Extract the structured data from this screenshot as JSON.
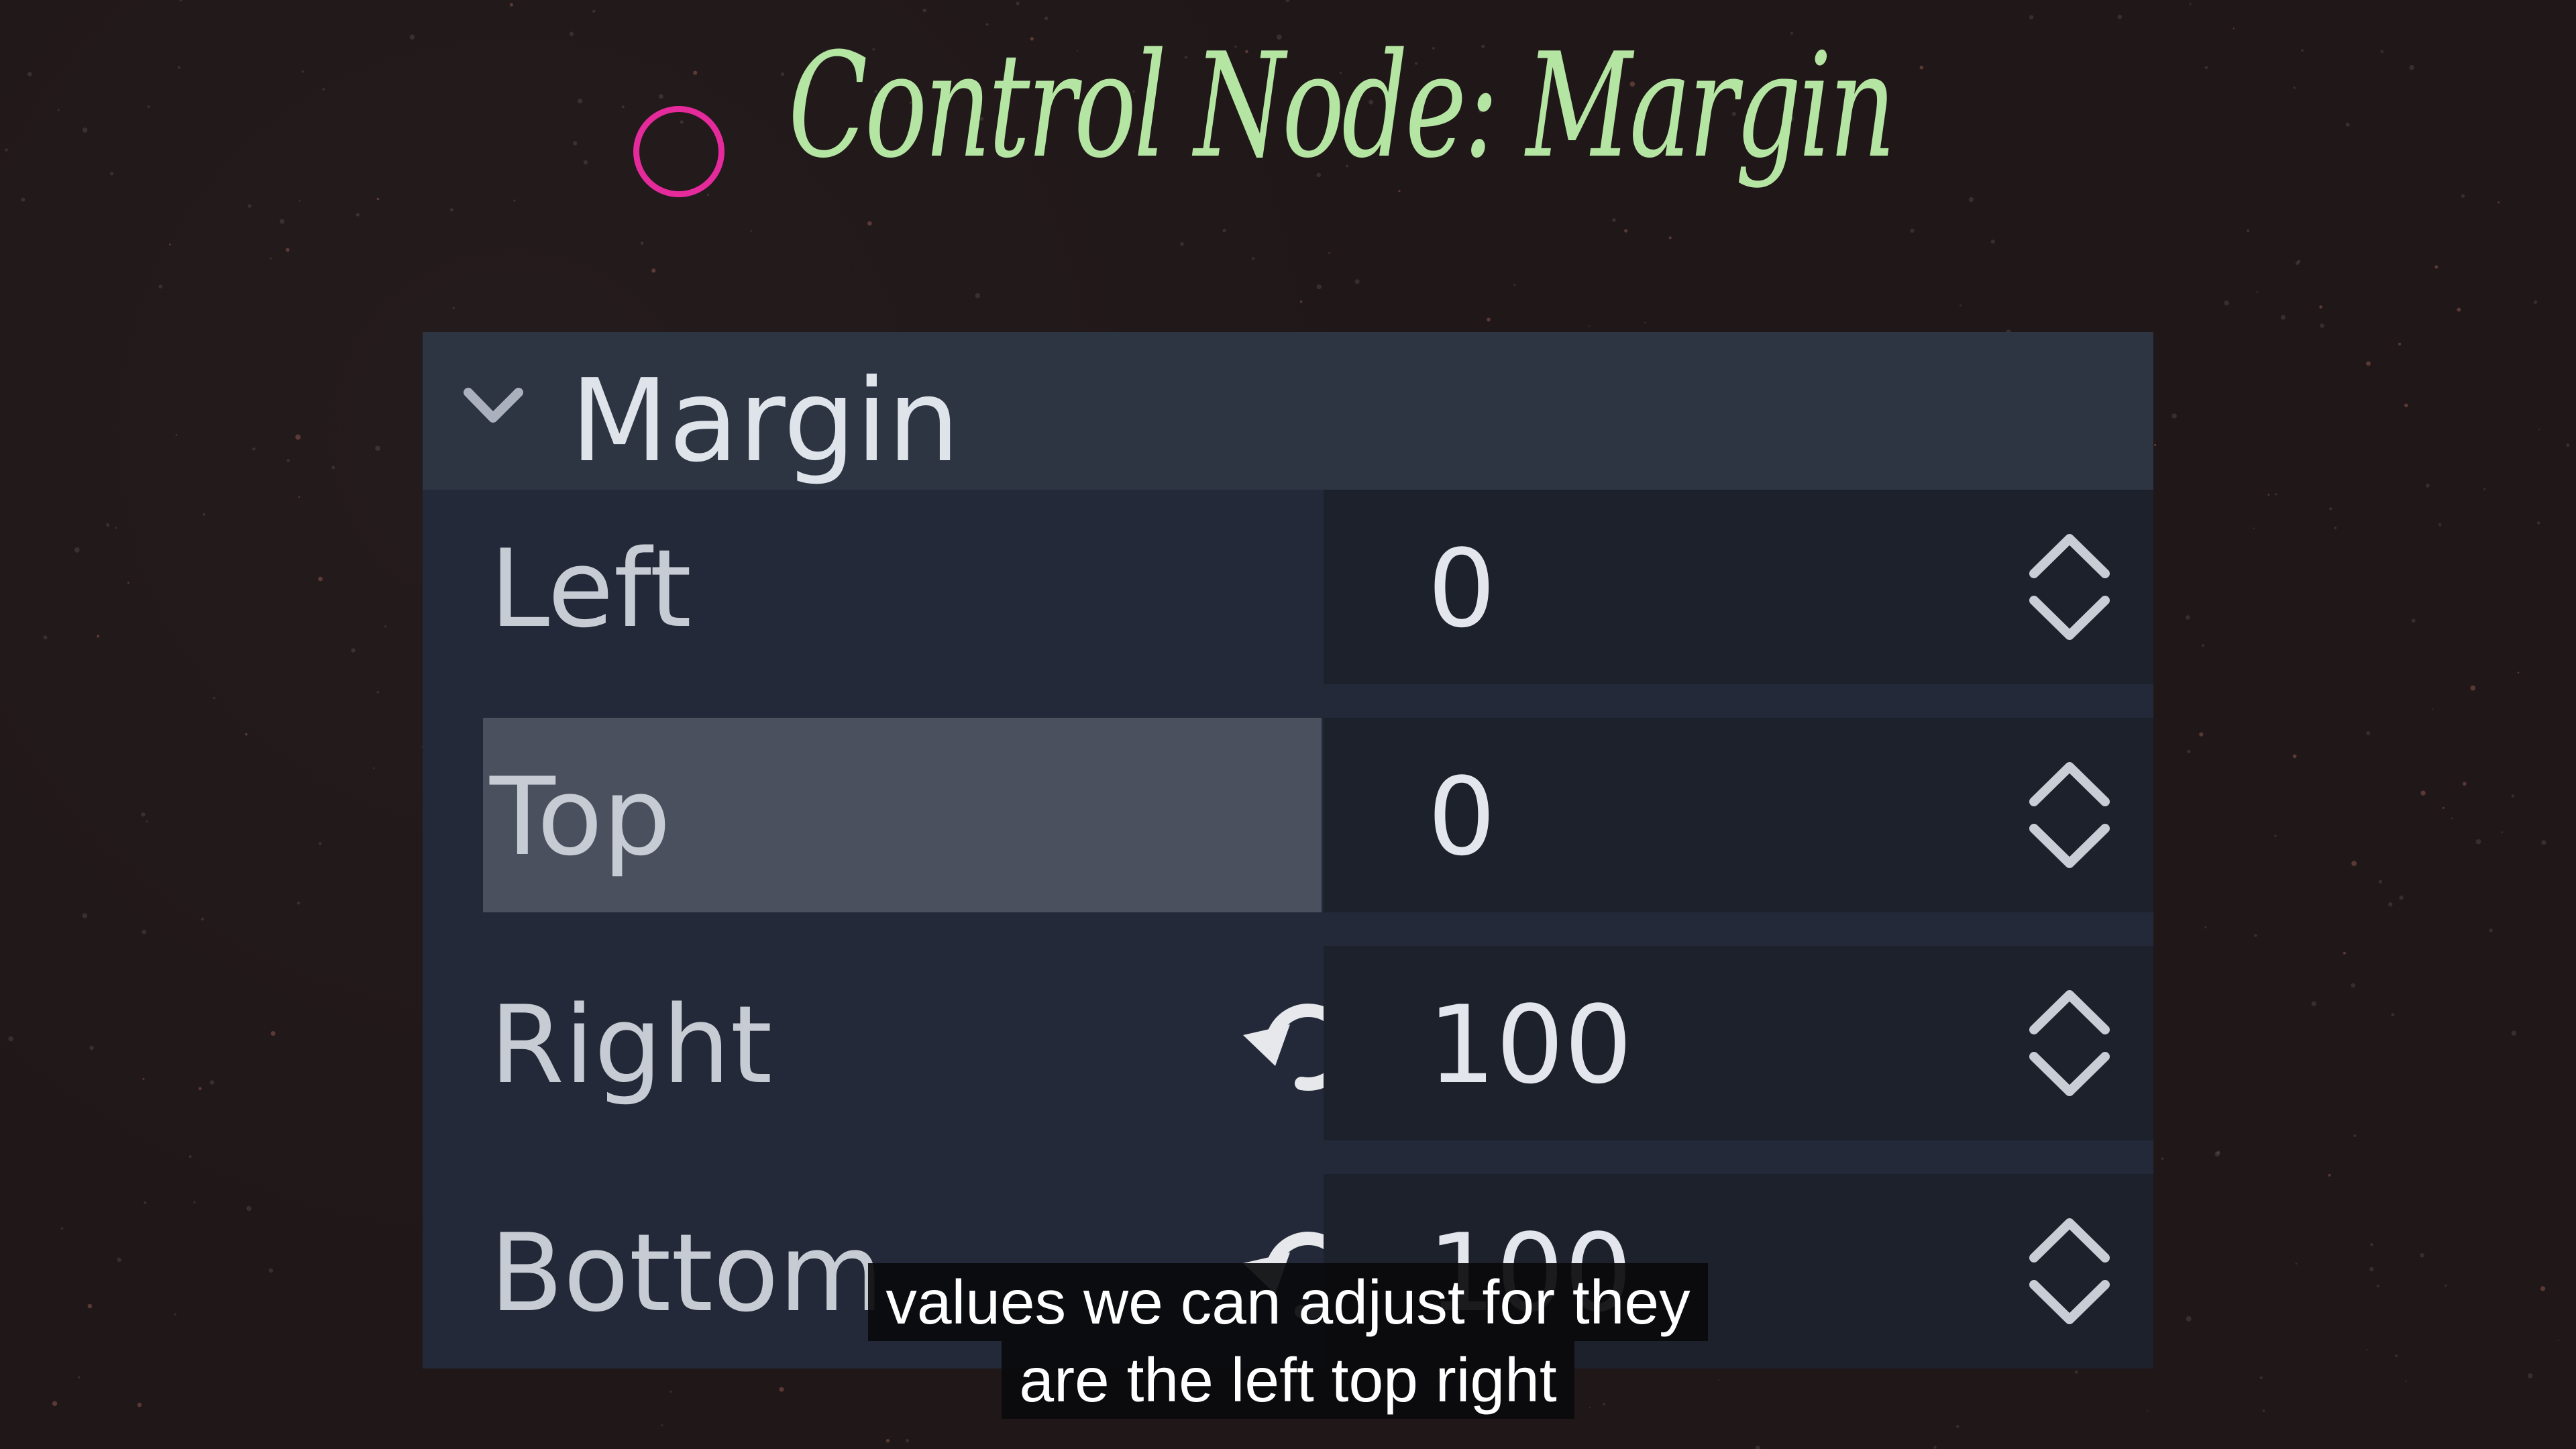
{
  "title": {
    "text": "Control Node: Margin",
    "bullet_color": "#e52a9c",
    "text_color": "#b5e5a2"
  },
  "inspector": {
    "section_title": "Margin",
    "section_icon": "chevron-down-icon",
    "rows": [
      {
        "label": "Left",
        "value": "0",
        "hovered": false,
        "has_reset": false
      },
      {
        "label": "Top",
        "value": "0",
        "hovered": true,
        "has_reset": false
      },
      {
        "label": "Right",
        "value": "100",
        "hovered": false,
        "has_reset": true
      },
      {
        "label": "Bottom",
        "value": "100",
        "hovered": false,
        "has_reset": true
      }
    ],
    "spinner_icon": "up-down-arrows-icon",
    "reset_icon": "revert-icon"
  },
  "captions": {
    "line1": "values we can adjust for they",
    "line2": "are the left top right"
  },
  "colors": {
    "background": "#201718",
    "panel": "#232938",
    "header": "#2d3442",
    "value_box": "#1c212b",
    "hover": "#4a505d"
  }
}
